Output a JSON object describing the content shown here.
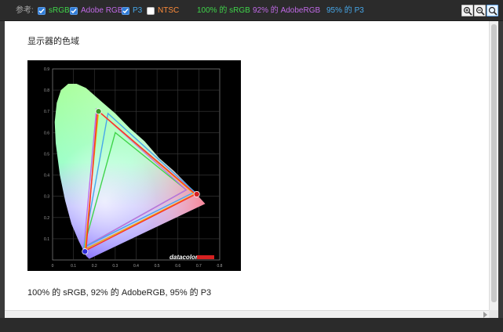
{
  "toolbar": {
    "reference_label": "参考:",
    "checkboxes": [
      {
        "label": "sRGB",
        "checked": true,
        "color": "#3fd44a"
      },
      {
        "label": "Adobe RGB",
        "checked": true,
        "color": "#c06ae6"
      },
      {
        "label": "P3",
        "checked": true,
        "color": "#47a8ea"
      },
      {
        "label": "NTSC",
        "checked": false,
        "color": "#ff8c3a"
      }
    ],
    "summaries": [
      {
        "text": "100% 的 sRGB",
        "color": "#3fd44a"
      },
      {
        "text": "92% 的 AdobeRGB",
        "color": "#c06ae6"
      },
      {
        "text": "95% 的 P3",
        "color": "#47a8ea"
      }
    ],
    "icons": [
      "zoom-in-icon",
      "zoom-out-icon",
      "zoom-fit-icon"
    ]
  },
  "content": {
    "title": "显示器的色域",
    "summary": "100% 的 sRGB, 92% 的 AdobeRGB, 95% 的 P3",
    "brand": "datacolor"
  },
  "chart_data": {
    "type": "scatter",
    "title": "",
    "xlabel": "",
    "ylabel": "",
    "x_ticks": [
      "0",
      "0.1",
      "0.2",
      "0.3",
      "0.4",
      "0.5",
      "0.6",
      "0.7",
      "0.8"
    ],
    "y_ticks": [
      "0.1",
      "0.2",
      "0.3",
      "0.4",
      "0.5",
      "0.6",
      "0.7",
      "0.8",
      "0.9"
    ],
    "xlim": [
      0,
      0.8
    ],
    "ylim": [
      0,
      0.9
    ],
    "grid": true,
    "series": [
      {
        "name": "sRGB",
        "color": "#3fd44a",
        "points": [
          [
            0.64,
            0.33
          ],
          [
            0.3,
            0.6
          ],
          [
            0.15,
            0.06
          ]
        ]
      },
      {
        "name": "Adobe RGB",
        "color": "#c06ae6",
        "points": [
          [
            0.64,
            0.33
          ],
          [
            0.21,
            0.71
          ],
          [
            0.15,
            0.06
          ]
        ]
      },
      {
        "name": "P3",
        "color": "#47a8ea",
        "points": [
          [
            0.68,
            0.32
          ],
          [
            0.265,
            0.69
          ],
          [
            0.15,
            0.06
          ]
        ]
      },
      {
        "name": "",
        "color": "#e8b400",
        "points": [
          [
            0.68,
            0.31
          ],
          [
            0.22,
            0.7
          ],
          [
            0.155,
            0.05
          ]
        ]
      },
      {
        "name": "",
        "color": "#ff2b2b",
        "points": [
          [
            0.685,
            0.31
          ],
          [
            0.215,
            0.705
          ],
          [
            0.16,
            0.045
          ]
        ]
      }
    ],
    "primaries": [
      {
        "name": "red",
        "x": 0.69,
        "y": 0.31,
        "color": "#d62020"
      },
      {
        "name": "green",
        "x": 0.22,
        "y": 0.7,
        "color": "#3a9a2a"
      },
      {
        "name": "blue",
        "x": 0.155,
        "y": 0.04,
        "color": "#2b2bd6"
      }
    ]
  }
}
